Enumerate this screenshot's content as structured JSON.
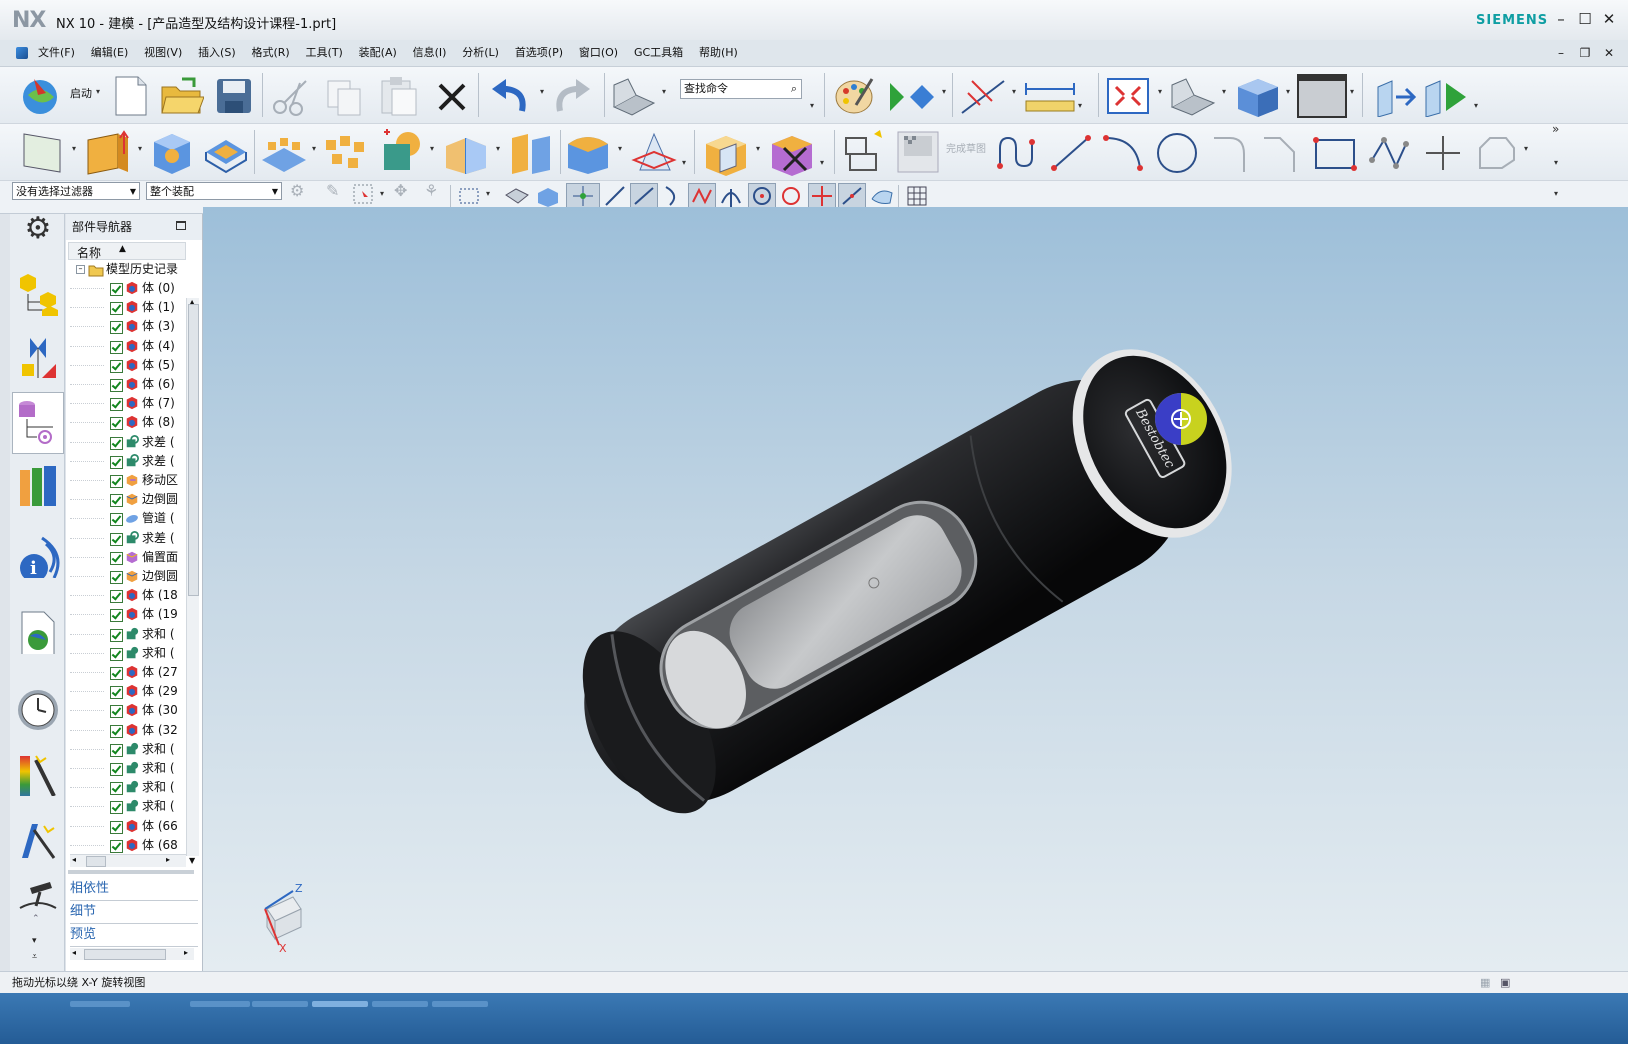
{
  "window": {
    "app_logo": "NX",
    "title": "NX 10 - 建模 - [产品造型及结构设计课程-1.prt]",
    "brand": "SIEMENS"
  },
  "menubar": {
    "items": [
      "文件(F)",
      "编辑(E)",
      "视图(V)",
      "插入(S)",
      "格式(R)",
      "工具(T)",
      "装配(A)",
      "信息(I)",
      "分析(L)",
      "首选项(P)",
      "窗口(O)",
      "GC工具箱",
      "帮助(H)"
    ]
  },
  "toolbar1": {
    "start_label": "启动",
    "search_placeholder": "查找命令"
  },
  "toolbar2": {
    "finish_sketch_label": "完成草图"
  },
  "toolbar3": {
    "selection_filter": "没有选择过滤器",
    "scope": "整个装配"
  },
  "navigator": {
    "title": "部件导航器",
    "column_name": "名称",
    "root": "模型历史记录",
    "rows": [
      {
        "label": "体 (0)",
        "icon": "body-icon"
      },
      {
        "label": "体 (1)",
        "icon": "body-icon"
      },
      {
        "label": "体 (3)",
        "icon": "body-icon"
      },
      {
        "label": "体 (4)",
        "icon": "body-icon"
      },
      {
        "label": "体 (5)",
        "icon": "body-icon"
      },
      {
        "label": "体 (6)",
        "icon": "body-icon"
      },
      {
        "label": "体 (7)",
        "icon": "body-icon"
      },
      {
        "label": "体 (8)",
        "icon": "body-icon"
      },
      {
        "label": "求差 (",
        "icon": "subtract-icon"
      },
      {
        "label": "求差 (",
        "icon": "subtract-icon"
      },
      {
        "label": "移动区",
        "icon": "move-face-icon"
      },
      {
        "label": "边倒圆",
        "icon": "edge-blend-icon"
      },
      {
        "label": "管道 (",
        "icon": "tube-icon"
      },
      {
        "label": "求差 (",
        "icon": "subtract-icon"
      },
      {
        "label": "偏置面",
        "icon": "offset-face-icon"
      },
      {
        "label": "边倒圆",
        "icon": "edge-blend-icon"
      },
      {
        "label": "体 (18",
        "icon": "body-icon"
      },
      {
        "label": "体 (19",
        "icon": "body-icon"
      },
      {
        "label": "求和 (",
        "icon": "unite-icon"
      },
      {
        "label": "求和 (",
        "icon": "unite-icon"
      },
      {
        "label": "体 (27",
        "icon": "body-icon"
      },
      {
        "label": "体 (29",
        "icon": "body-icon"
      },
      {
        "label": "体 (30",
        "icon": "body-icon"
      },
      {
        "label": "体 (32",
        "icon": "body-icon"
      },
      {
        "label": "求和 (",
        "icon": "unite-icon"
      },
      {
        "label": "求和 (",
        "icon": "unite-icon"
      },
      {
        "label": "求和 (",
        "icon": "unite-icon"
      },
      {
        "label": "求和 (",
        "icon": "unite-icon"
      },
      {
        "label": "体 (66",
        "icon": "body-icon"
      },
      {
        "label": "体 (68",
        "icon": "body-icon"
      }
    ],
    "panels": [
      "相依性",
      "细节",
      "预览"
    ]
  },
  "viewport": {
    "triad_z": "Z",
    "triad_x": "X",
    "logo_text": "Bestobtec"
  },
  "status": {
    "message": "拖动光标以绕 X-Y 旋转视图"
  },
  "colors": {
    "accent": "#0f9ea3",
    "link": "#2a66b0",
    "bg_top": "#9dbfd9",
    "bg_bottom": "#e4ecf1"
  }
}
